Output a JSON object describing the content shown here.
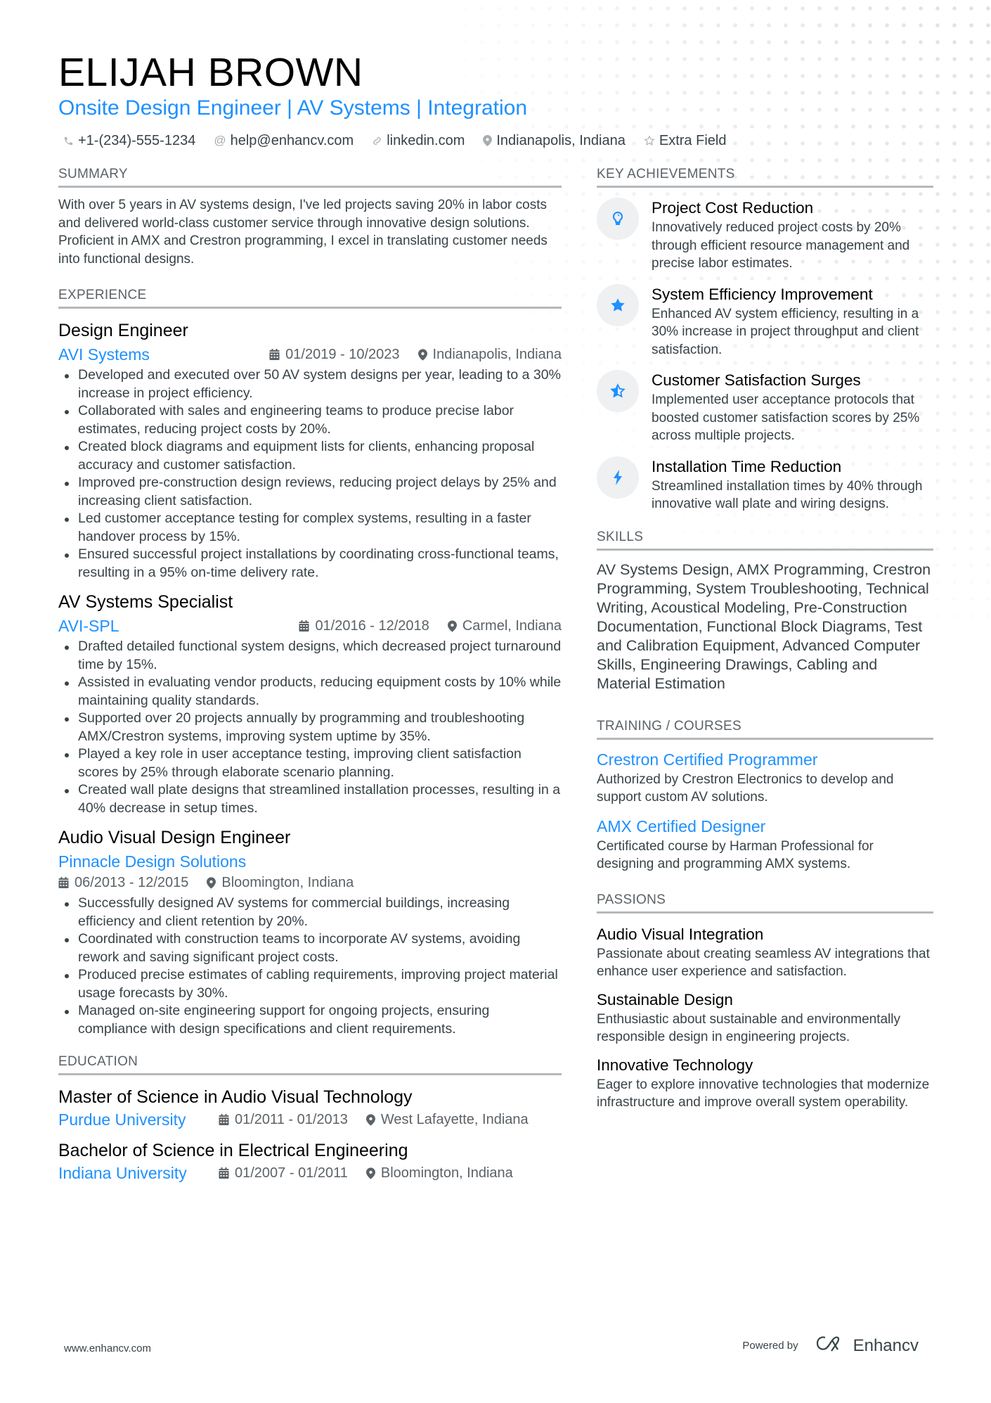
{
  "header": {
    "name": "ELIJAH BROWN",
    "title": "Onsite Design Engineer | AV Systems | Integration",
    "contacts": [
      {
        "icon": "phone-icon",
        "text": "+1-(234)-555-1234"
      },
      {
        "icon": "at-icon",
        "text": "help@enhancv.com"
      },
      {
        "icon": "link-icon",
        "text": "linkedin.com"
      },
      {
        "icon": "location-icon",
        "text": "Indianapolis, Indiana"
      },
      {
        "icon": "star-outline-icon",
        "text": "Extra Field"
      }
    ]
  },
  "colors": {
    "accent": "#1e90ff",
    "text": "#384347",
    "heading": "#000000",
    "section_rule": "#b4b8ba",
    "icon_bg": "#eef0f1"
  },
  "summary": {
    "heading": "SUMMARY",
    "text": "With over 5 years in AV systems design, I've led projects saving 20% in labor costs and delivered world-class customer service through innovative design solutions. Proficient in AMX and Crestron programming, I excel in translating customer needs into functional designs."
  },
  "experience": {
    "heading": "EXPERIENCE",
    "jobs": [
      {
        "title": "Design Engineer",
        "company": "AVI Systems",
        "dates": "01/2019 - 10/2023",
        "location": "Indianapolis, Indiana",
        "bullets": [
          "Developed and executed over 50 AV system designs per year, leading to a 30% increase in project efficiency.",
          "Collaborated with sales and engineering teams to produce precise labor estimates, reducing project costs by 20%.",
          "Created block diagrams and equipment lists for clients, enhancing proposal accuracy and customer satisfaction.",
          "Improved pre-construction design reviews, reducing project delays by 25% and increasing client satisfaction.",
          "Led customer acceptance testing for complex systems, resulting in a faster handover process by 15%.",
          "Ensured successful project installations by coordinating cross-functional teams, resulting in a 95% on-time delivery rate."
        ]
      },
      {
        "title": "AV Systems Specialist",
        "company": "AVI-SPL",
        "dates": "01/2016 - 12/2018",
        "location": "Carmel, Indiana",
        "bullets": [
          "Drafted detailed functional system designs, which decreased project turnaround time by 15%.",
          "Assisted in evaluating vendor products, reducing equipment costs by 10% while maintaining quality standards.",
          "Supported over 20 projects annually by programming and troubleshooting AMX/Crestron systems, improving system uptime by 35%.",
          "Played a key role in user acceptance testing, improving client satisfaction scores by 25% through elaborate scenario planning.",
          "Created wall plate designs that streamlined installation processes, resulting in a 40% decrease in setup times."
        ]
      },
      {
        "title": "Audio Visual Design Engineer",
        "company": "Pinnacle Design Solutions",
        "dates": "06/2013 - 12/2015",
        "location": "Bloomington, Indiana",
        "bullets": [
          "Successfully designed AV systems for commercial buildings, increasing efficiency and client retention by 20%.",
          "Coordinated with construction teams to incorporate AV systems, avoiding rework and saving significant project costs.",
          "Produced precise estimates of cabling requirements, improving project material usage forecasts by 30%.",
          "Managed on-site engineering support for ongoing projects, ensuring compliance with design specifications and client requirements."
        ]
      }
    ]
  },
  "education": {
    "heading": "EDUCATION",
    "items": [
      {
        "degree": "Master of Science in Audio Visual Technology",
        "school": "Purdue University",
        "dates": "01/2011 - 01/2013",
        "location": "West Lafayette, Indiana"
      },
      {
        "degree": "Bachelor of Science in Electrical Engineering",
        "school": "Indiana University",
        "dates": "01/2007 - 01/2011",
        "location": "Bloomington, Indiana"
      }
    ]
  },
  "achievements": {
    "heading": "KEY ACHIEVEMENTS",
    "items": [
      {
        "icon": "lightbulb-icon",
        "title": "Project Cost Reduction",
        "description": "Innovatively reduced project costs by 20% through efficient resource management and precise labor estimates."
      },
      {
        "icon": "star-icon",
        "title": "System Efficiency Improvement",
        "description": "Enhanced AV system efficiency, resulting in a 30% increase in project throughput and client satisfaction."
      },
      {
        "icon": "star-half-icon",
        "title": "Customer Satisfaction Surges",
        "description": "Implemented user acceptance protocols that boosted customer satisfaction scores by 25% across multiple projects."
      },
      {
        "icon": "lightning-icon",
        "title": "Installation Time Reduction",
        "description": "Streamlined installation times by 40% through innovative wall plate and wiring designs."
      }
    ]
  },
  "skills": {
    "heading": "SKILLS",
    "text": "AV Systems Design, AMX Programming, Crestron Programming, System Troubleshooting, Technical Writing, Acoustical Modeling, Pre-Construction Documentation, Functional Block Diagrams, Test and Calibration Equipment, Advanced Computer Skills, Engineering Drawings, Cabling and Material Estimation"
  },
  "training": {
    "heading": "TRAINING / COURSES",
    "items": [
      {
        "title": "Crestron Certified Programmer",
        "description": "Authorized by Crestron Electronics to develop and support custom AV solutions."
      },
      {
        "title": "AMX Certified Designer",
        "description": "Certificated course by Harman Professional for designing and programming AMX systems."
      }
    ]
  },
  "passions": {
    "heading": "PASSIONS",
    "items": [
      {
        "title": "Audio Visual Integration",
        "description": "Passionate about creating seamless AV integrations that enhance user experience and satisfaction."
      },
      {
        "title": "Sustainable Design",
        "description": "Enthusiastic about sustainable and environmentally responsible design in engineering projects."
      },
      {
        "title": "Innovative Technology",
        "description": "Eager to explore innovative technologies that modernize infrastructure and improve overall system operability."
      }
    ]
  },
  "footer": {
    "website": "www.enhancv.com",
    "powered_by": "Powered by",
    "brand": "Enhancv"
  }
}
